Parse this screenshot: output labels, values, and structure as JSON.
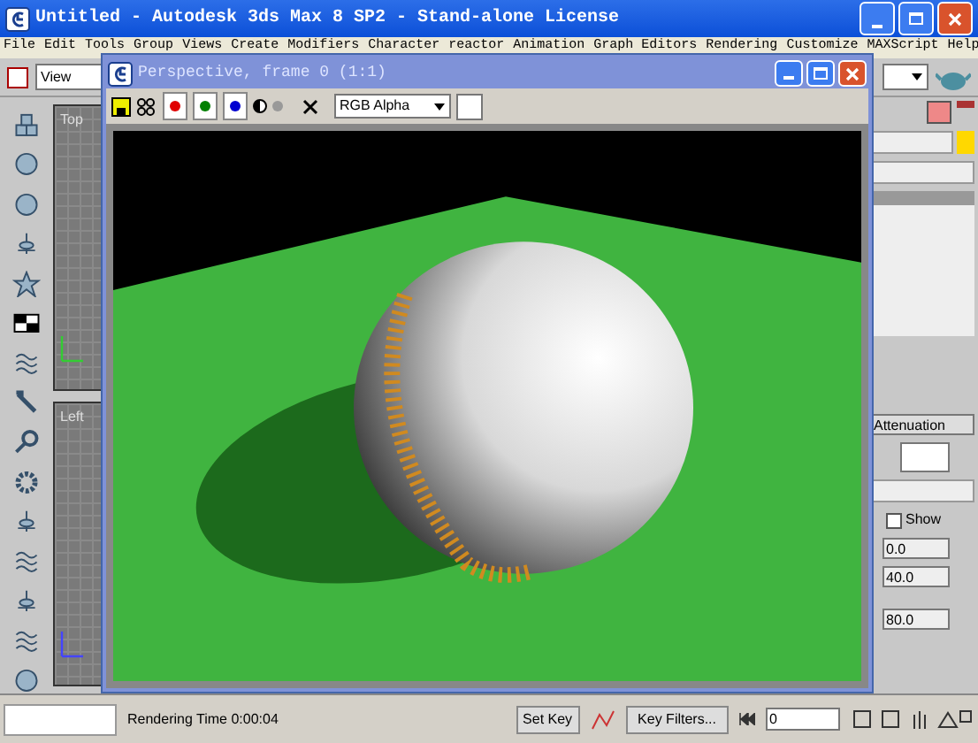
{
  "window": {
    "title": "Untitled  - Autodesk 3ds Max 8 SP2  - Stand-alone License"
  },
  "menu": [
    "File",
    "Edit",
    "Tools",
    "Group",
    "Views",
    "Create",
    "Modifiers",
    "Character",
    "reactor",
    "Animation",
    "Graph Editors",
    "Rendering",
    "Customize",
    "MAXScript",
    "Help"
  ],
  "toolbar": {
    "view_dropdown": "View"
  },
  "viewports": [
    {
      "label": "Top"
    },
    {
      "label": "Left"
    }
  ],
  "render_window": {
    "title": "Perspective, frame 0 (1:1)",
    "channels": [
      {
        "color": "#e00000",
        "on": true
      },
      {
        "color": "#008000",
        "on": true
      },
      {
        "color": "#0000d0",
        "on": true
      }
    ],
    "channel_dropdown": "RGB Alpha"
  },
  "command_panel": {
    "rollout_button": "Attenuation",
    "checkbox": {
      "label": "Show",
      "checked": false
    },
    "fields": [
      "0.0",
      "40.0",
      "80.0"
    ]
  },
  "status_bar": {
    "message": "Rendering Time  0:00:04",
    "set_key": "Set Key",
    "key_filters": "Key Filters...",
    "frame": "0"
  }
}
